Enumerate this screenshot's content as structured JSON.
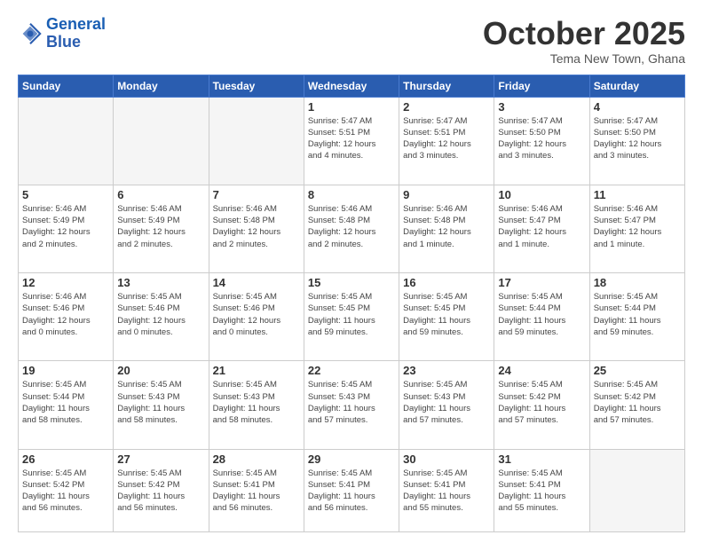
{
  "header": {
    "logo_general": "General",
    "logo_blue": "Blue",
    "month": "October 2025",
    "location": "Tema New Town, Ghana"
  },
  "days_of_week": [
    "Sunday",
    "Monday",
    "Tuesday",
    "Wednesday",
    "Thursday",
    "Friday",
    "Saturday"
  ],
  "weeks": [
    [
      {
        "day": "",
        "info": ""
      },
      {
        "day": "",
        "info": ""
      },
      {
        "day": "",
        "info": ""
      },
      {
        "day": "1",
        "info": "Sunrise: 5:47 AM\nSunset: 5:51 PM\nDaylight: 12 hours\nand 4 minutes."
      },
      {
        "day": "2",
        "info": "Sunrise: 5:47 AM\nSunset: 5:51 PM\nDaylight: 12 hours\nand 3 minutes."
      },
      {
        "day": "3",
        "info": "Sunrise: 5:47 AM\nSunset: 5:50 PM\nDaylight: 12 hours\nand 3 minutes."
      },
      {
        "day": "4",
        "info": "Sunrise: 5:47 AM\nSunset: 5:50 PM\nDaylight: 12 hours\nand 3 minutes."
      }
    ],
    [
      {
        "day": "5",
        "info": "Sunrise: 5:46 AM\nSunset: 5:49 PM\nDaylight: 12 hours\nand 2 minutes."
      },
      {
        "day": "6",
        "info": "Sunrise: 5:46 AM\nSunset: 5:49 PM\nDaylight: 12 hours\nand 2 minutes."
      },
      {
        "day": "7",
        "info": "Sunrise: 5:46 AM\nSunset: 5:48 PM\nDaylight: 12 hours\nand 2 minutes."
      },
      {
        "day": "8",
        "info": "Sunrise: 5:46 AM\nSunset: 5:48 PM\nDaylight: 12 hours\nand 2 minutes."
      },
      {
        "day": "9",
        "info": "Sunrise: 5:46 AM\nSunset: 5:48 PM\nDaylight: 12 hours\nand 1 minute."
      },
      {
        "day": "10",
        "info": "Sunrise: 5:46 AM\nSunset: 5:47 PM\nDaylight: 12 hours\nand 1 minute."
      },
      {
        "day": "11",
        "info": "Sunrise: 5:46 AM\nSunset: 5:47 PM\nDaylight: 12 hours\nand 1 minute."
      }
    ],
    [
      {
        "day": "12",
        "info": "Sunrise: 5:46 AM\nSunset: 5:46 PM\nDaylight: 12 hours\nand 0 minutes."
      },
      {
        "day": "13",
        "info": "Sunrise: 5:45 AM\nSunset: 5:46 PM\nDaylight: 12 hours\nand 0 minutes."
      },
      {
        "day": "14",
        "info": "Sunrise: 5:45 AM\nSunset: 5:46 PM\nDaylight: 12 hours\nand 0 minutes."
      },
      {
        "day": "15",
        "info": "Sunrise: 5:45 AM\nSunset: 5:45 PM\nDaylight: 11 hours\nand 59 minutes."
      },
      {
        "day": "16",
        "info": "Sunrise: 5:45 AM\nSunset: 5:45 PM\nDaylight: 11 hours\nand 59 minutes."
      },
      {
        "day": "17",
        "info": "Sunrise: 5:45 AM\nSunset: 5:44 PM\nDaylight: 11 hours\nand 59 minutes."
      },
      {
        "day": "18",
        "info": "Sunrise: 5:45 AM\nSunset: 5:44 PM\nDaylight: 11 hours\nand 59 minutes."
      }
    ],
    [
      {
        "day": "19",
        "info": "Sunrise: 5:45 AM\nSunset: 5:44 PM\nDaylight: 11 hours\nand 58 minutes."
      },
      {
        "day": "20",
        "info": "Sunrise: 5:45 AM\nSunset: 5:43 PM\nDaylight: 11 hours\nand 58 minutes."
      },
      {
        "day": "21",
        "info": "Sunrise: 5:45 AM\nSunset: 5:43 PM\nDaylight: 11 hours\nand 58 minutes."
      },
      {
        "day": "22",
        "info": "Sunrise: 5:45 AM\nSunset: 5:43 PM\nDaylight: 11 hours\nand 57 minutes."
      },
      {
        "day": "23",
        "info": "Sunrise: 5:45 AM\nSunset: 5:43 PM\nDaylight: 11 hours\nand 57 minutes."
      },
      {
        "day": "24",
        "info": "Sunrise: 5:45 AM\nSunset: 5:42 PM\nDaylight: 11 hours\nand 57 minutes."
      },
      {
        "day": "25",
        "info": "Sunrise: 5:45 AM\nSunset: 5:42 PM\nDaylight: 11 hours\nand 57 minutes."
      }
    ],
    [
      {
        "day": "26",
        "info": "Sunrise: 5:45 AM\nSunset: 5:42 PM\nDaylight: 11 hours\nand 56 minutes."
      },
      {
        "day": "27",
        "info": "Sunrise: 5:45 AM\nSunset: 5:42 PM\nDaylight: 11 hours\nand 56 minutes."
      },
      {
        "day": "28",
        "info": "Sunrise: 5:45 AM\nSunset: 5:41 PM\nDaylight: 11 hours\nand 56 minutes."
      },
      {
        "day": "29",
        "info": "Sunrise: 5:45 AM\nSunset: 5:41 PM\nDaylight: 11 hours\nand 56 minutes."
      },
      {
        "day": "30",
        "info": "Sunrise: 5:45 AM\nSunset: 5:41 PM\nDaylight: 11 hours\nand 55 minutes."
      },
      {
        "day": "31",
        "info": "Sunrise: 5:45 AM\nSunset: 5:41 PM\nDaylight: 11 hours\nand 55 minutes."
      },
      {
        "day": "",
        "info": ""
      }
    ]
  ]
}
